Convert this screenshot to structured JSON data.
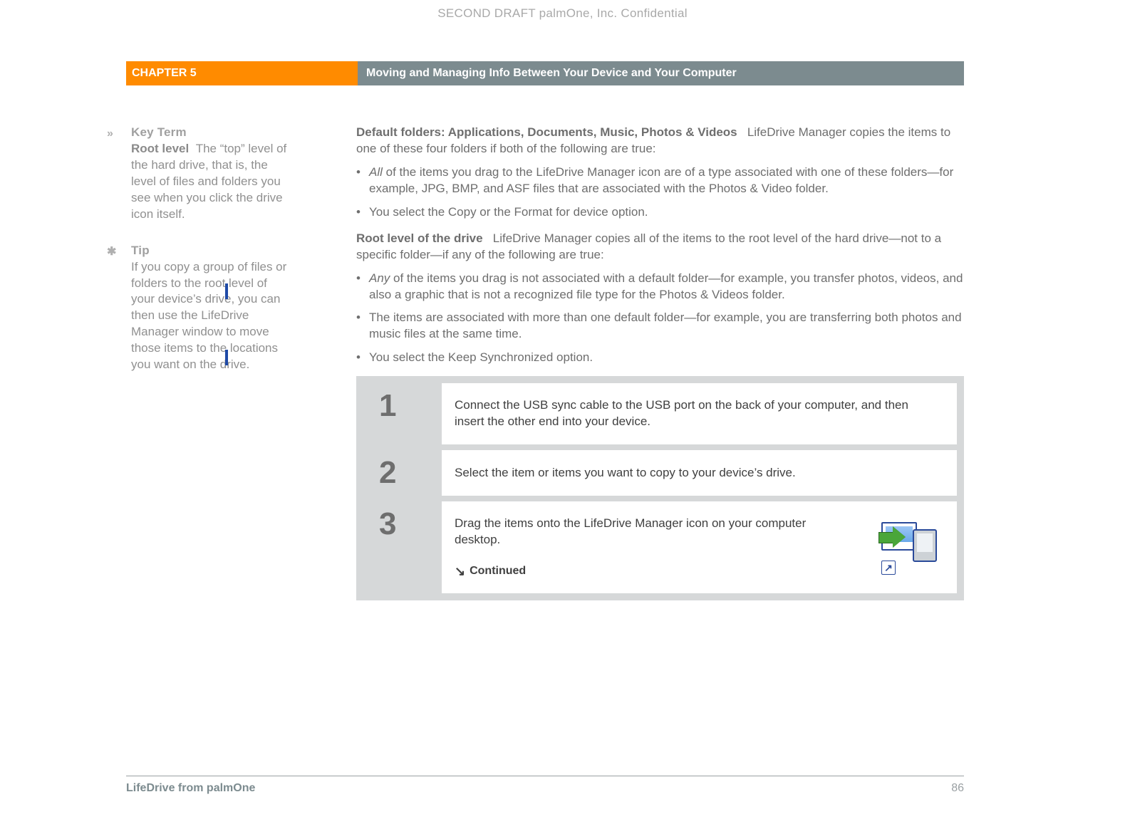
{
  "watermark": "SECOND DRAFT palmOne, Inc.  Confidential",
  "header": {
    "chapter": "CHAPTER 5",
    "title": "Moving and Managing Info Between Your Device and Your Computer"
  },
  "sidebar": {
    "keyterm": {
      "glyph": "»",
      "heading": "Key Term",
      "term": "Root level",
      "text": "The “top” level of the hard drive, that is, the level of files and folders you see when you click the drive icon itself."
    },
    "tip": {
      "glyph": "*",
      "heading": "Tip",
      "text": "If you copy a group of files or folders to the root level of your device’s drive, you can then use the LifeDrive Manager window to move those items to the locations you want on the drive."
    }
  },
  "body": {
    "defaultFolders": {
      "lead_bold": "Default folders: Applications, Documents, Music, Photos & Videos",
      "lead_rest": "LifeDrive Manager copies the items to one of these four folders if both of the following are true:",
      "bullets": [
        {
          "emph": "All",
          "rest": " of the items you drag to the LifeDrive Manager icon are of a type associated with one of these folders—for example, JPG, BMP, and ASF files that are associated with the Photos & Video folder."
        },
        {
          "rest": "You select the Copy or the Format for device option."
        }
      ]
    },
    "rootLevel": {
      "lead_bold": "Root level of the drive",
      "lead_rest": "LifeDrive Manager copies all of the items to the root level of the hard drive—not to a specific folder—if any of the following are true:",
      "bullets": [
        {
          "emph": "Any",
          "rest": " of the items you drag is not associated with a default folder—for example, you transfer photos, videos, and also a graphic that is not a recognized file type for the Photos & Videos folder."
        },
        {
          "rest": "The items are associated with more than one default folder—for example, you are transferring both photos and music files at the same time."
        },
        {
          "rest": "You select the Keep Synchronized option."
        }
      ]
    }
  },
  "steps": [
    {
      "num": "1",
      "text": "Connect the USB sync cable to the USB port on the back of your computer, and then insert the other end into your device."
    },
    {
      "num": "2",
      "text": "Select the item or items you want to copy to your device’s drive."
    },
    {
      "num": "3",
      "text": "Drag the items onto the LifeDrive Manager icon on your computer desktop.",
      "continued": "Continued"
    }
  ],
  "footer": {
    "product": "LifeDrive from palmOne",
    "page": "86"
  },
  "icons": {
    "continued_arrow": "↘",
    "shortcut_arrow": "↗",
    "tip_star": "✱"
  }
}
